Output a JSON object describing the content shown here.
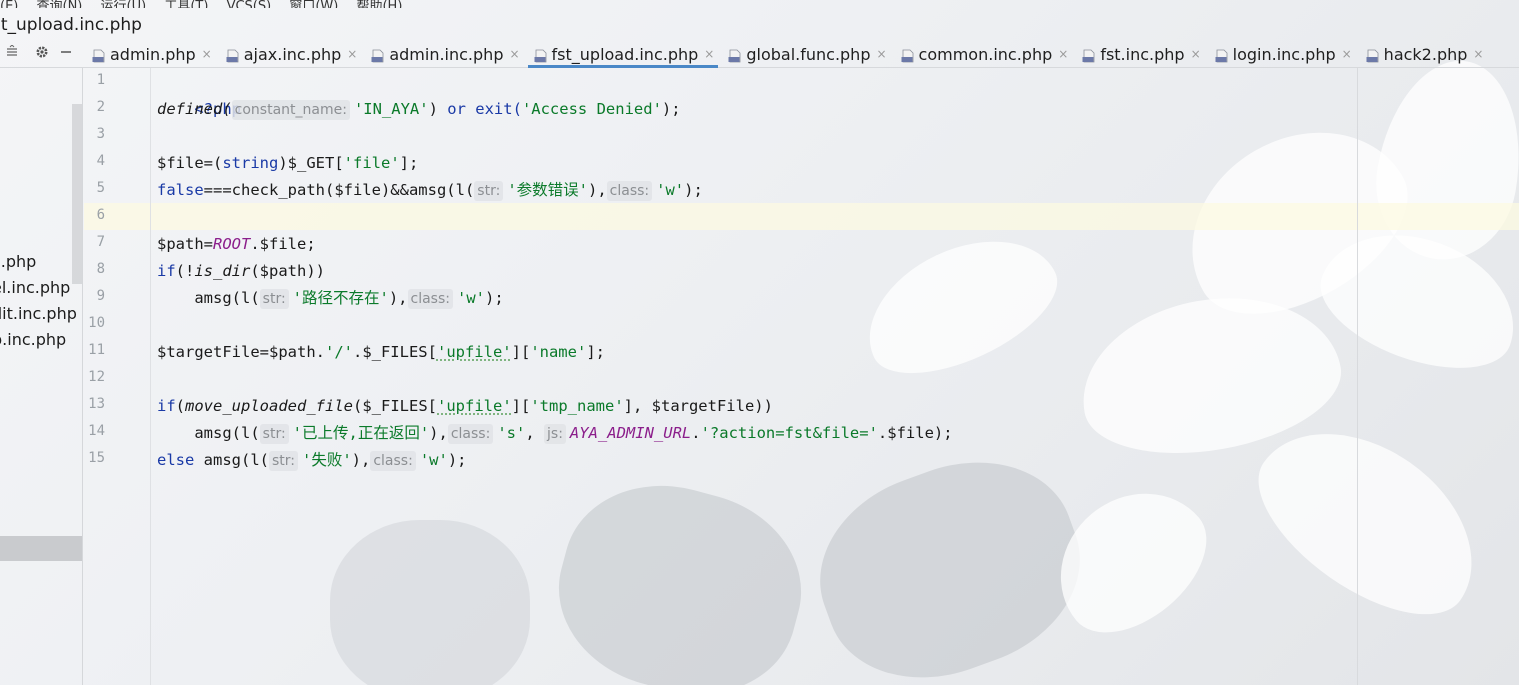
{
  "menubar": {
    "items": [
      "(E)",
      "查询(N)",
      "运行(U)",
      "工具(T)",
      "VCS(S)",
      "窗口(W)",
      "帮助(H)"
    ]
  },
  "window": {
    "title": "st_upload.inc.php"
  },
  "tabs": [
    {
      "label": "admin.php",
      "active": false
    },
    {
      "label": "ajax.inc.php",
      "active": false
    },
    {
      "label": "admin.inc.php",
      "active": false
    },
    {
      "label": "fst_upload.inc.php",
      "active": true
    },
    {
      "label": "global.func.php",
      "active": false
    },
    {
      "label": "common.inc.php",
      "active": false
    },
    {
      "label": "fst.inc.php",
      "active": false
    },
    {
      "label": "login.inc.php",
      "active": false
    },
    {
      "label": "hack2.php",
      "active": false
    }
  ],
  "tab_close_glyph": "×",
  "project_files": [
    "c.php",
    "el.inc.php",
    "dit.inc.php",
    "p.inc.php"
  ],
  "line_numbers": [
    "1",
    "2",
    "3",
    "4",
    "5",
    "6",
    "7",
    "8",
    "9",
    "10",
    "11",
    "12",
    "13",
    "14",
    "15"
  ],
  "code": {
    "l1": {
      "open": "<?php"
    },
    "l2": {
      "fn": "defined(",
      "hint": "constant_name:",
      "arg": "'IN_AYA'",
      "mid": ") ",
      "or": "or",
      "exit": " exit(",
      "msg": "'Access Denied'",
      "end": ");"
    },
    "l4": {
      "var": "$file",
      "eq": "=(",
      "cast": "string",
      "get": ")$_GET[",
      "key": "'file'",
      "end": "];"
    },
    "l5": {
      "false": "false",
      "rest": "===check_path($file)&&amsg(l(",
      "hint1": "str:",
      "s1": "'参数错误'",
      "mid": "),",
      "hint2": "class:",
      "s2": "'w'",
      "end": ");"
    },
    "l7": {
      "var": "$path",
      "eq": "=",
      "const": "ROOT",
      "rest": ".$file;"
    },
    "l8": {
      "if": "if",
      "open": "(!",
      "fn": "is_dir",
      "rest": "($path))"
    },
    "l9": {
      "fn": "    amsg(l(",
      "hint1": "str:",
      "s1": "'路径不存在'",
      "mid": "),",
      "hint2": "class:",
      "s2": "'w'",
      "end": ");"
    },
    "l11": {
      "var": "$targetFile",
      "eq": "=$path.",
      "slash": "'/'",
      "rest": ".$_FILES[",
      "k1": "'upfile'",
      "br": "][",
      "k2": "'name'",
      "end": "];"
    },
    "l13": {
      "if": "if",
      "open": "(",
      "fn": "move_uploaded_file",
      "rest": "($_FILES[",
      "k1": "'upfile'",
      "br": "][",
      "k2": "'tmp_name'",
      "end": "], $targetFile))"
    },
    "l14": {
      "fn": "    amsg(l(",
      "hint1": "str:",
      "s1": "'已上传,正在返回'",
      "mid": "),",
      "hint2": "class:",
      "s2": "'s'",
      "comma": ",",
      "hint3": "js:",
      "const": "AYA_ADMIN_URL",
      "dot": ".",
      "s3": "'?action=fst&file='",
      "end": ".$file);"
    },
    "l15": {
      "else": "else",
      "fn": " amsg(l(",
      "hint1": "str:",
      "s1": "'失败'",
      "mid": "),",
      "hint2": "class:",
      "s2": "'w'",
      "end": ");"
    }
  },
  "colors": {
    "keyword": "#1a3aa6",
    "string": "#0b7a2a",
    "constant": "#8b1e8b",
    "active_tab": "#4a88c7"
  }
}
